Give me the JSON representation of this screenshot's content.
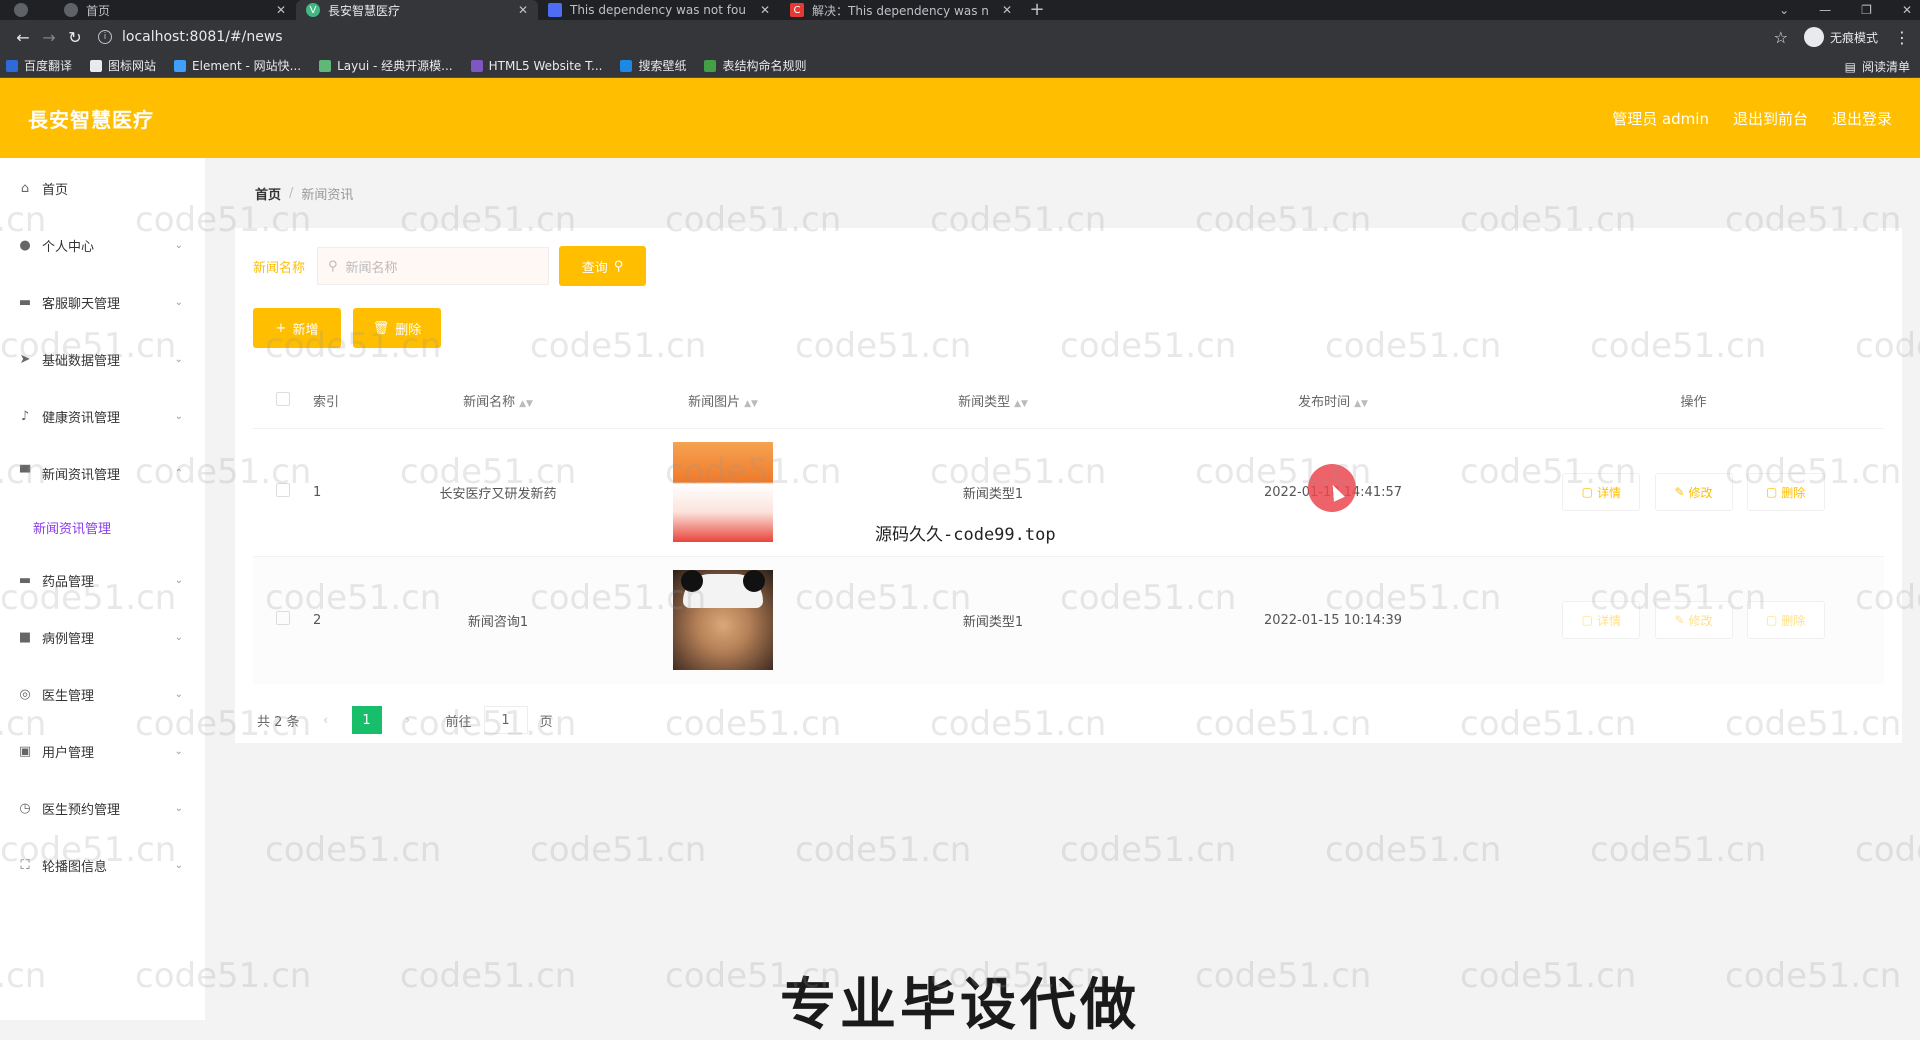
{
  "browser": {
    "tabs": [
      {
        "title": "首页",
        "active": false,
        "fav_color": "#5f6368"
      },
      {
        "title": "長安智慧医疗",
        "active": true,
        "fav_color": "#41b883"
      },
      {
        "title": "This dependency was not fou",
        "active": false,
        "fav_color": "#4e6ef2"
      },
      {
        "title": "解决：This dependency was n",
        "active": false,
        "fav_color": "#e53935"
      }
    ],
    "url": "localhost:8081/#/news",
    "incognito_label": "无痕模式",
    "bookmarks": [
      {
        "label": "百度翻译",
        "color": "#2f6bd8"
      },
      {
        "label": "图标网站",
        "color": "#e8eaed"
      },
      {
        "label": "Element - 网站快...",
        "color": "#409eff"
      },
      {
        "label": "Layui - 经典开源模...",
        "color": "#5fb878"
      },
      {
        "label": "HTML5 Website T...",
        "color": "#7e57c2"
      },
      {
        "label": "搜索壁纸",
        "color": "#1e88e5"
      },
      {
        "label": "表结构命名规则",
        "color": "#43a047"
      }
    ],
    "reading_list": "阅读清单"
  },
  "header": {
    "brand": "長安智慧医疗",
    "admin": "管理员 admin",
    "back_front": "退出到前台",
    "logout": "退出登录"
  },
  "sidebar": {
    "items": [
      {
        "label": "首页",
        "icon": "home-icon"
      },
      {
        "label": "个人中心",
        "icon": "user-icon"
      },
      {
        "label": "客服聊天管理",
        "icon": "chat-icon"
      },
      {
        "label": "基础数据管理",
        "icon": "send-icon"
      },
      {
        "label": "健康资讯管理",
        "icon": "mic-icon"
      },
      {
        "label": "新闻资讯管理",
        "icon": "news-icon"
      },
      {
        "label": "药品管理",
        "icon": "medicine-icon"
      },
      {
        "label": "病例管理",
        "icon": "case-icon"
      },
      {
        "label": "医生管理",
        "icon": "doctor-icon"
      },
      {
        "label": "用户管理",
        "icon": "users-icon"
      },
      {
        "label": "医生预约管理",
        "icon": "appointment-icon"
      },
      {
        "label": "轮播图信息",
        "icon": "carousel-icon"
      }
    ],
    "submenu": "新闻资讯管理"
  },
  "breadcrumb": {
    "home": "首页",
    "current": "新闻资讯"
  },
  "search": {
    "label": "新闻名称",
    "placeholder": "新闻名称",
    "query_button": "查询"
  },
  "actions": {
    "add": "新增",
    "delete": "删除"
  },
  "table": {
    "headers": {
      "index": "索引",
      "name": "新闻名称",
      "image": "新闻图片",
      "type": "新闻类型",
      "time": "发布时间",
      "ops": "操作"
    },
    "rows": [
      {
        "index": "1",
        "name": "长安医疗又研发新药",
        "type": "新闻类型1",
        "time": "2022-01-18 14:41:57"
      },
      {
        "index": "2",
        "name": "新闻咨询1",
        "type": "新闻类型1",
        "time": "2022-01-15 10:14:39"
      }
    ],
    "op_labels": {
      "detail": "详情",
      "edit": "修改",
      "delete": "删除"
    }
  },
  "pagination": {
    "total": "共 2 条",
    "current": "1",
    "goto": "前往",
    "page_input": "1",
    "page_unit": "页"
  },
  "overlay": {
    "source_text": "源码久久-code99.top",
    "caption": "专业毕设代做",
    "watermark": "code51.cn"
  }
}
